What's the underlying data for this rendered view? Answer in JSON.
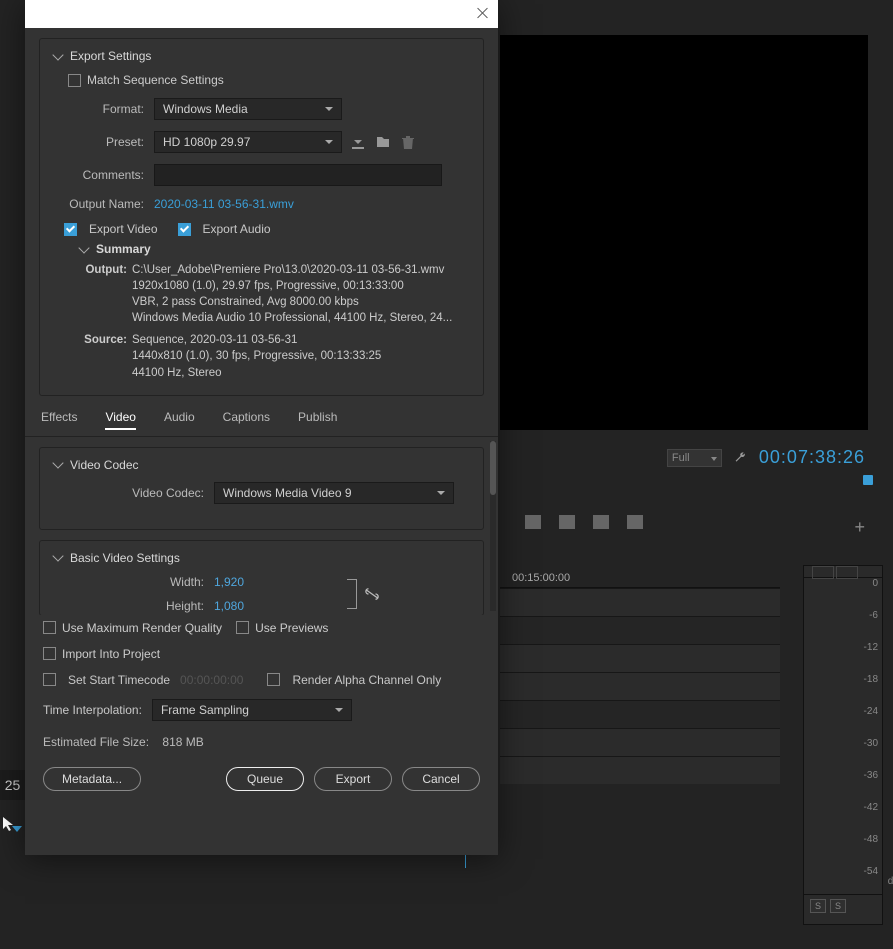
{
  "preview": {
    "quality": "Full",
    "timecode": "00:07:38:26"
  },
  "timeline": {
    "rulerLabel": "00:15:00:00",
    "sideLabel": "25"
  },
  "audioMeter": {
    "labels": [
      "0",
      "-6",
      "-12",
      "-18",
      "-24",
      "-30",
      "-36",
      "-42",
      "-48",
      "-54"
    ],
    "unit": "dB",
    "solo": "S"
  },
  "export": {
    "headerTitle": "Export Settings",
    "matchSequence": "Match Sequence Settings",
    "formatLabel": "Format:",
    "formatValue": "Windows Media",
    "presetLabel": "Preset:",
    "presetValue": "HD 1080p 29.97",
    "commentsLabel": "Comments:",
    "outputNameLabel": "Output Name:",
    "outputNameValue": "2020-03-11 03-56-31.wmv",
    "exportVideo": "Export Video",
    "exportAudio": "Export Audio",
    "summary": {
      "title": "Summary",
      "outputLabel": "Output:",
      "outputText": "C:\\User_Adobe\\Premiere Pro\\13.0\\2020-03-11 03-56-31.wmv\n1920x1080 (1.0), 29.97 fps, Progressive, 00:13:33:00\nVBR, 2 pass Constrained, Avg 8000.00 kbps\nWindows Media Audio 10 Professional, 44100 Hz, Stereo, 24...",
      "sourceLabel": "Source:",
      "sourceText": "Sequence, 2020-03-11 03-56-31\n1440x810 (1.0), 30 fps, Progressive, 00:13:33:25\n44100 Hz, Stereo"
    }
  },
  "tabs": {
    "effects": "Effects",
    "video": "Video",
    "audio": "Audio",
    "captions": "Captions",
    "publish": "Publish"
  },
  "videoCodec": {
    "title": "Video Codec",
    "label": "Video Codec:",
    "value": "Windows Media Video 9"
  },
  "basicVideo": {
    "title": "Basic Video Settings",
    "widthLabel": "Width:",
    "widthValue": "1,920",
    "heightLabel": "Height:",
    "heightValue": "1,080"
  },
  "bottom": {
    "useMaxRender": "Use Maximum Render Quality",
    "usePreviews": "Use Previews",
    "importProject": "Import Into Project",
    "setStartTC": "Set Start Timecode",
    "startTCValue": "00:00:00:00",
    "renderAlpha": "Render Alpha Channel Only",
    "tiLabel": "Time Interpolation:",
    "tiValue": "Frame Sampling",
    "efsLabel": "Estimated File Size:",
    "efsValue": "818 MB",
    "metadata": "Metadata...",
    "queue": "Queue",
    "exportBtn": "Export",
    "cancel": "Cancel"
  }
}
